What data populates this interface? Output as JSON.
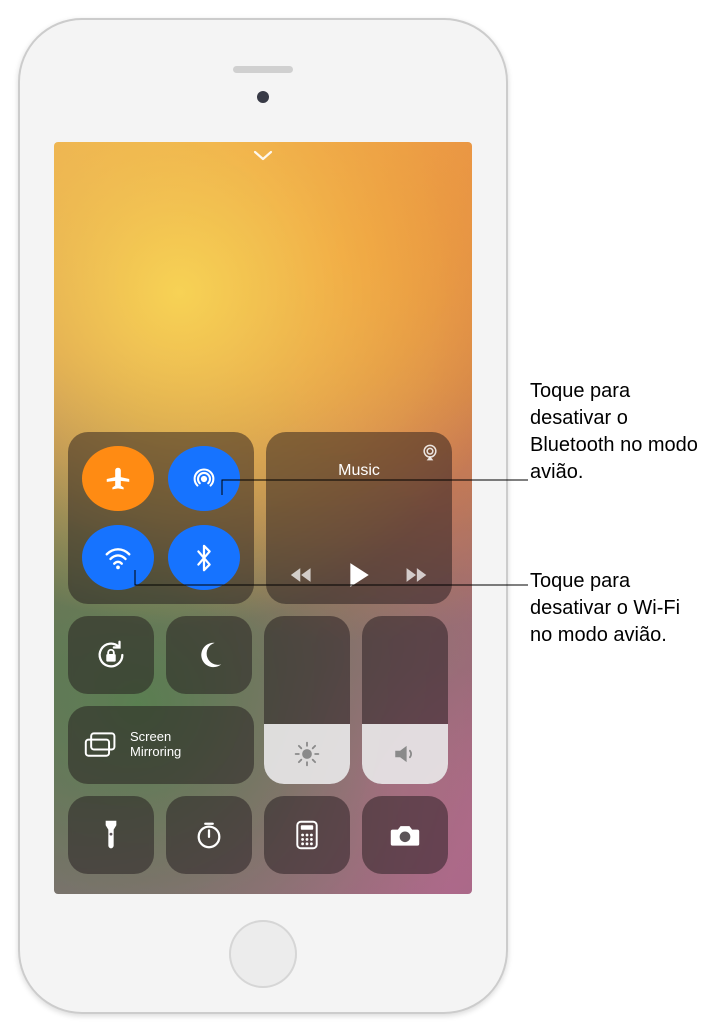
{
  "media": {
    "title": "Music"
  },
  "mirroring": {
    "label": "Screen\nMirroring"
  },
  "callouts": {
    "bluetooth": "Toque para desativar o Bluetooth no modo avião.",
    "wifi": "Toque para desativar o Wi-Fi no modo avião."
  },
  "icons": {
    "airplane": "airplane",
    "airdrop": "airdrop",
    "wifi": "wifi",
    "bluetooth": "bluetooth",
    "airplay": "airplay-audio",
    "rewind": "rewind",
    "play": "play",
    "forward": "forward",
    "orientation_lock": "orientation-lock",
    "dnd": "moon",
    "brightness": "sun",
    "volume": "speaker",
    "screen_mirror": "rectangles",
    "flashlight": "flashlight",
    "timer": "timer",
    "calculator": "calculator",
    "camera": "camera",
    "chevron": "chevron-down"
  }
}
